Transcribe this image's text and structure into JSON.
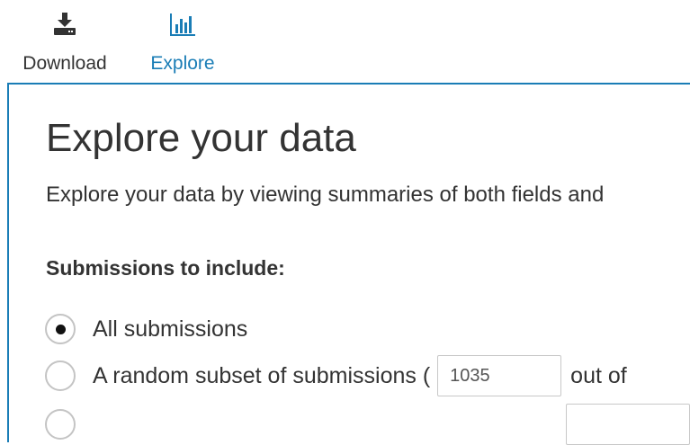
{
  "tabs": [
    {
      "label": "Download",
      "icon": "download-icon",
      "active": false
    },
    {
      "label": "Explore",
      "icon": "bar-chart-icon",
      "active": true
    }
  ],
  "main": {
    "title": "Explore your data",
    "description": "Explore your data by viewing summaries of both fields and",
    "section_label": "Submissions to include:",
    "options": [
      {
        "label": "All submissions",
        "selected": true
      },
      {
        "label_prefix": "A random subset of submissions (",
        "input_value": "1035",
        "suffix": "out of",
        "selected": false
      }
    ]
  },
  "colors": {
    "accent": "#1a7db6",
    "text": "#333333",
    "border": "#c4c4c4"
  }
}
